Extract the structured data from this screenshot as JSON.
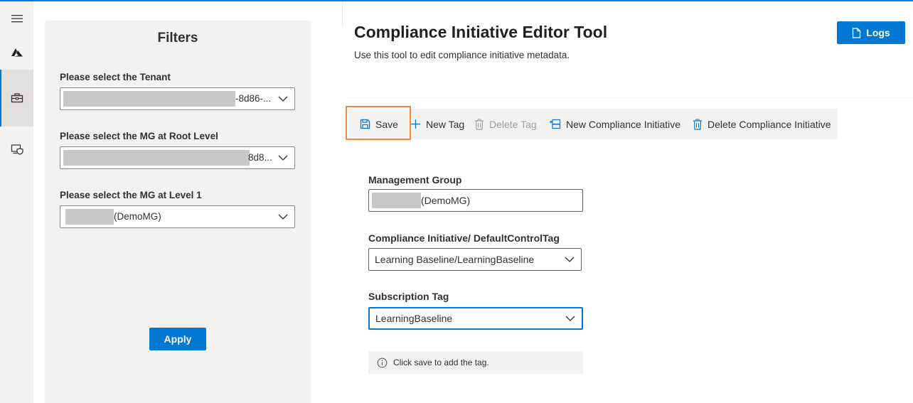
{
  "nav": {
    "items": [
      {
        "icon": "hamburger-icon"
      },
      {
        "icon": "azure-logo-icon"
      },
      {
        "icon": "toolbox-icon"
      },
      {
        "icon": "policy-shield-icon"
      }
    ]
  },
  "filters": {
    "title": "Filters",
    "tenant_label": "Please select the Tenant",
    "tenant_value": "-8d86-...",
    "root_mg_label": "Please select the MG at Root Level",
    "root_mg_value": "8d8...",
    "level1_label": "Please select the MG at Level 1",
    "level1_value": "(DemoMG)",
    "apply_label": "Apply"
  },
  "header": {
    "title": "Compliance Initiative Editor Tool",
    "description": "Use this tool to edit compliance initiative metadata.",
    "logs_label": "Logs"
  },
  "commandbar": {
    "save": "Save",
    "new_tag": "New Tag",
    "delete_tag": "Delete Tag",
    "new_initiative": "New Compliance Initiative",
    "delete_initiative": "Delete Compliance Initiative"
  },
  "form": {
    "mg_label": "Management Group",
    "mg_value": "(DemoMG)",
    "initiative_label": "Compliance Initiative/ DefaultControlTag",
    "initiative_value": "Learning Baseline/LearningBaseline",
    "subscription_label": "Subscription Tag",
    "subscription_value": "LearningBaseline",
    "info_text": "Click save to add the tag."
  },
  "colors": {
    "accent": "#0078d4",
    "highlight": "#f0883e",
    "panel": "#f3f2f1"
  }
}
